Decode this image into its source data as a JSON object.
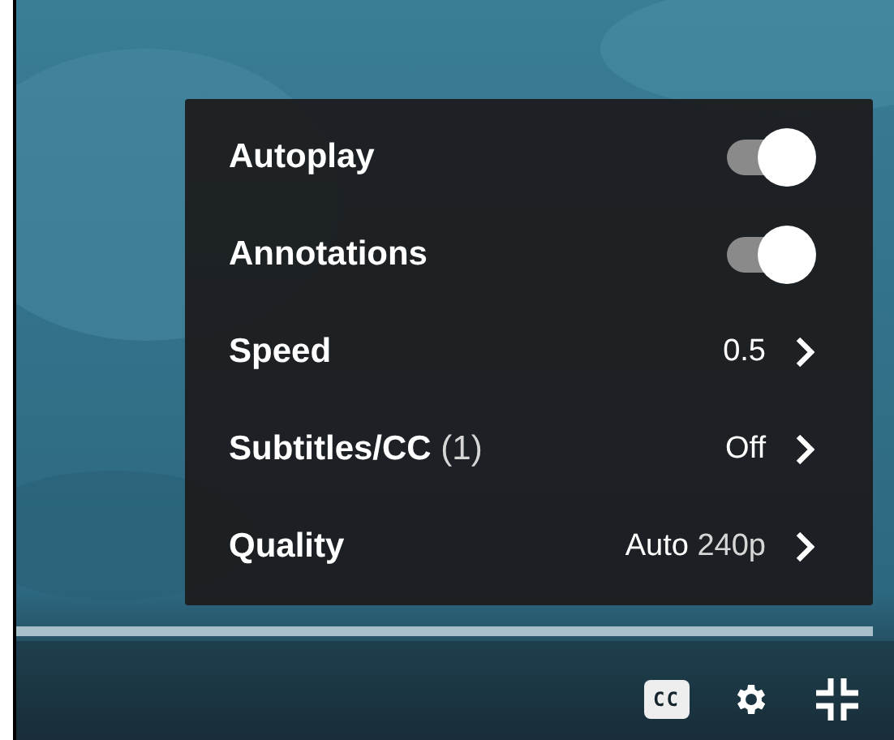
{
  "settings_menu": {
    "items": [
      {
        "kind": "toggle",
        "label": "Autoplay",
        "on": true
      },
      {
        "kind": "toggle",
        "label": "Annotations",
        "on": true
      },
      {
        "kind": "submenu",
        "label": "Speed",
        "value": "0.5"
      },
      {
        "kind": "submenu",
        "label": "Subtitles/CC",
        "label_note": "(1)",
        "value": "Off"
      },
      {
        "kind": "submenu",
        "label": "Quality",
        "value": "Auto",
        "value_note": "240p"
      }
    ]
  },
  "progress": {
    "level": 1
  },
  "controls": {
    "captions_label": "CC"
  }
}
